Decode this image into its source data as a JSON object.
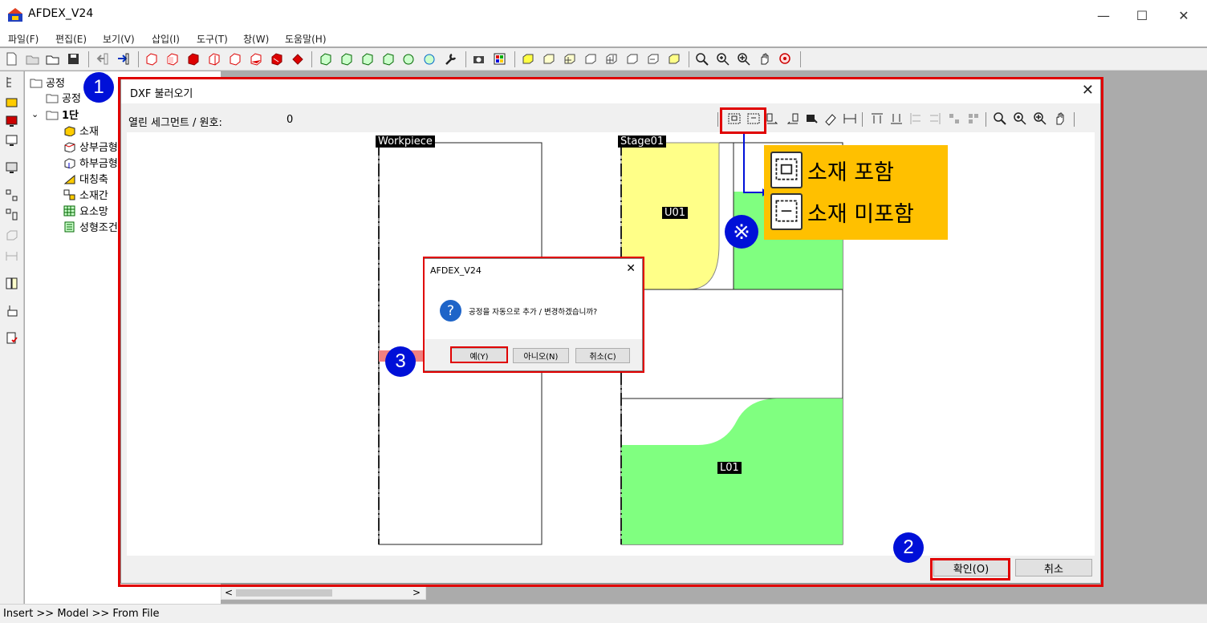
{
  "app": {
    "title": "AFDEX_V24",
    "minimize_glyph": "—",
    "maximize_glyph": "☐",
    "close_glyph": "✕"
  },
  "menu": {
    "items": [
      "파일(F)",
      "편집(E)",
      "보기(V)",
      "삽입(I)",
      "도구(T)",
      "창(W)",
      "도움말(H)"
    ]
  },
  "tree": {
    "root": "공정",
    "child": "공정",
    "stage": "1단",
    "items": [
      "소재",
      "상부금형",
      "하부금형",
      "대칭축",
      "소재간",
      "요소망",
      "성형조건"
    ]
  },
  "dxf_dialog": {
    "title": "DXF 불러오기",
    "close_glyph": "✕",
    "info_label": "열린 세그먼트 / 원호:",
    "info_value": "0",
    "workpiece_label": "Workpiece",
    "stage_label": "Stage01",
    "upper_label": "U01",
    "lower_label": "L01",
    "ok_button": "확인(O)",
    "cancel_button": "취소"
  },
  "confirm_dialog": {
    "title": "AFDEX_V24",
    "close_glyph": "✕",
    "icon_glyph": "?",
    "message": "공정을 자동으로 추가 / 변경하겠습니까?",
    "yes_button": "예(Y)",
    "no_button": "아니오(N)",
    "cancel_button": "취소(C)"
  },
  "annotations": {
    "badge_1": "1",
    "badge_2": "2",
    "badge_3": "3",
    "note_mark": "※",
    "include_text": "소재 포함",
    "exclude_text": "소재 미포함"
  },
  "status": {
    "text": "Insert >> Model >> From File"
  },
  "scroll": {
    "left_arrow": "<",
    "right_arrow": ">"
  },
  "colors": {
    "accent_red": "#e00000",
    "badge_blue": "#0010d8",
    "callout_yellow": "#ffc000",
    "upper_die_yellow": "#ffff88",
    "die_green": "#80ff80"
  }
}
